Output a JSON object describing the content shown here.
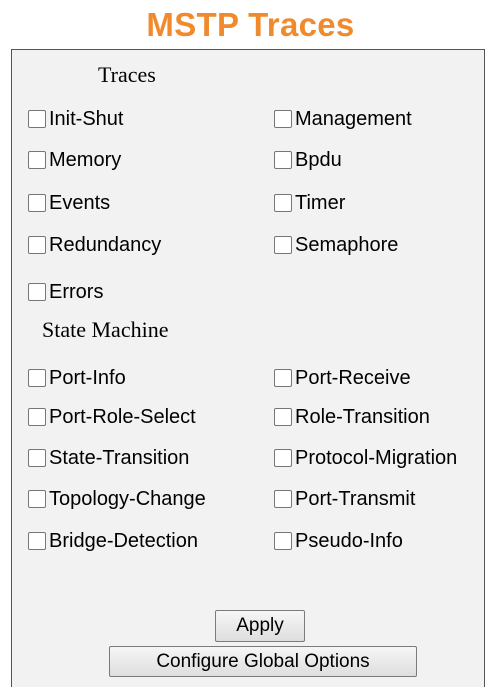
{
  "page": {
    "title": "MSTP Traces"
  },
  "traces": {
    "heading": "Traces",
    "items": [
      {
        "label": "Init-Shut",
        "checked": false
      },
      {
        "label": "Management",
        "checked": false
      },
      {
        "label": "Memory",
        "checked": false
      },
      {
        "label": "Bpdu",
        "checked": false
      },
      {
        "label": "Events",
        "checked": false
      },
      {
        "label": "Timer",
        "checked": false
      },
      {
        "label": "Redundancy",
        "checked": false
      },
      {
        "label": "Semaphore",
        "checked": false
      },
      {
        "label": "Errors",
        "checked": false
      }
    ]
  },
  "state_machine": {
    "heading": "State Machine",
    "items": [
      {
        "label": "Port-Info",
        "checked": false
      },
      {
        "label": "Port-Receive",
        "checked": false
      },
      {
        "label": "Port-Role-Select",
        "checked": false
      },
      {
        "label": "Role-Transition",
        "checked": false
      },
      {
        "label": "State-Transition",
        "checked": false
      },
      {
        "label": "Protocol-Migration",
        "checked": false
      },
      {
        "label": "Topology-Change",
        "checked": false
      },
      {
        "label": "Port-Transmit",
        "checked": false
      },
      {
        "label": "Bridge-Detection",
        "checked": false
      },
      {
        "label": "Pseudo-Info",
        "checked": false
      }
    ]
  },
  "buttons": {
    "apply": "Apply",
    "configure_global": "Configure Global Options"
  },
  "colors": {
    "title": "#f08a2c",
    "panel_background": "#f2f2f2",
    "panel_border": "#555555"
  }
}
